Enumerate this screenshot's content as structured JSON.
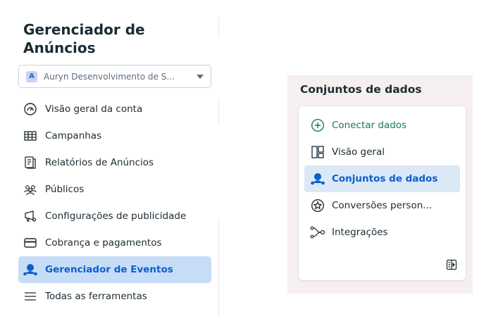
{
  "app": {
    "title": "Gerenciador de Anúncios"
  },
  "account": {
    "initial": "A",
    "name": "Auryn Desenvolvimento de S..."
  },
  "sidebar": {
    "items": [
      {
        "label": "Visão geral da conta",
        "icon": "dashboard-gauge-icon"
      },
      {
        "label": "Campanhas",
        "icon": "table-grid-icon"
      },
      {
        "label": "Relatórios de Anúncios",
        "icon": "report-icon"
      },
      {
        "label": "Públicos",
        "icon": "audience-icon"
      },
      {
        "label": "Configurações de publicidade",
        "icon": "settings-ad-icon"
      },
      {
        "label": "Cobrança e pagamentos",
        "icon": "credit-card-icon"
      },
      {
        "label": "Gerenciador de Eventos",
        "icon": "events-manager-icon",
        "active": true
      },
      {
        "label": "Todas as ferramentas",
        "icon": "hamburger-menu-icon"
      }
    ]
  },
  "panel": {
    "title": "Conjuntos de dados",
    "items": [
      {
        "label": "Conectar dados",
        "icon": "plus-circle-icon"
      },
      {
        "label": "Visão geral",
        "icon": "overview-layout-icon"
      },
      {
        "label": "Conjuntos de dados",
        "icon": "datasets-icon",
        "active": true
      },
      {
        "label": "Conversões person...",
        "icon": "star-badge-icon"
      },
      {
        "label": "Integrações",
        "icon": "integrations-icon"
      }
    ]
  },
  "colors": {
    "accent_blue": "#0a5fcc",
    "active_bg": "#c7ddf7",
    "connect_green": "#1a7a56",
    "panel_bg": "#f6eff0"
  }
}
